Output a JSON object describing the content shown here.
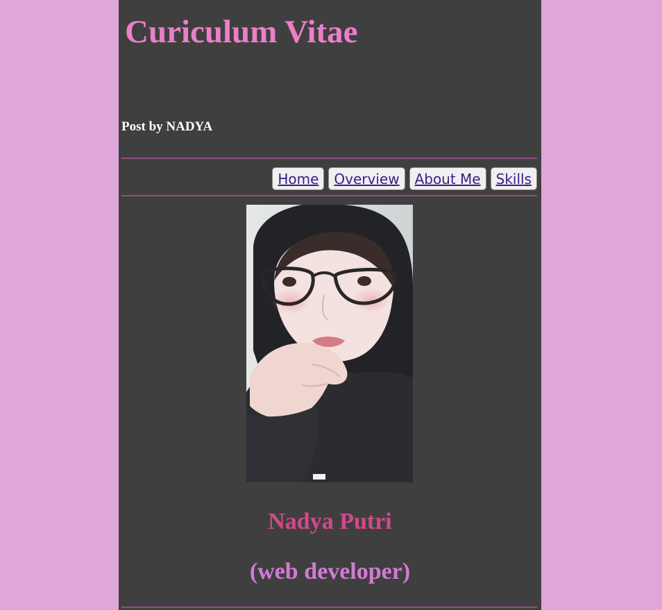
{
  "header": {
    "title": "Curiculum Vitae",
    "post_by": "Post by NADYA"
  },
  "nav": {
    "items": [
      {
        "label": "Home"
      },
      {
        "label": "Overview"
      },
      {
        "label": "About Me"
      },
      {
        "label": "Skills"
      }
    ]
  },
  "profile": {
    "name": "Nadya Putri",
    "role": "(web developer)"
  },
  "colors": {
    "page_background": "#dfa6da",
    "content_background": "#403f3f",
    "title": "#ec7fc9",
    "divider": "#8f4f8a",
    "name": "#d2498c",
    "role": "#d17bd7",
    "link": "#3b1b8a"
  }
}
